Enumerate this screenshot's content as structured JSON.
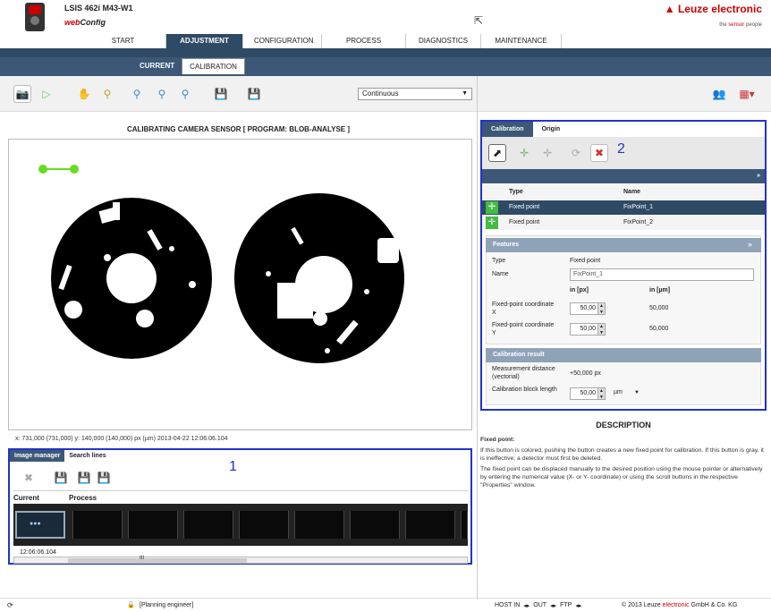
{
  "header": {
    "device_name": "LSIS 462i M43-W1",
    "web_prefix": "web",
    "config_word": "Config",
    "brand": "Leuze electronic",
    "tagline_pre": "the ",
    "tagline_sensor": "sensor",
    "tagline_post": " people"
  },
  "nav": [
    "START",
    "ADJUSTMENT",
    "CONFIGURATION",
    "PROCESS",
    "DIAGNOSTICS",
    "MAINTENANCE"
  ],
  "subtabs": [
    "CURRENT",
    "CALIBRATION"
  ],
  "toolbar": {
    "trigger_mode": "Continuous"
  },
  "main": {
    "title": "CALIBRATING CAMERA SENSOR   [ PROGRAM: BLOB-ANALYSE ]",
    "coords": "x: 731,000 (731,000) y: 140,000 (140,000) px (µm)     2013-04-22 12:06:06.104"
  },
  "image_panel": {
    "tabs": [
      "Image manager",
      "Search lines"
    ],
    "number": "1",
    "col_current": "Current",
    "col_process": "Process",
    "timestamp": "12:06:06.104",
    "scroll_mark": "III"
  },
  "calib_panel": {
    "tabs": [
      "Calibration",
      "Origin"
    ],
    "number": "2",
    "col_type": "Type",
    "col_name": "Name",
    "rows": [
      {
        "type": "Fixed point",
        "name": "FixPoint_1"
      },
      {
        "type": "Fixed point",
        "name": "FixPoint_2"
      }
    ],
    "features_title": "Features",
    "type_label": "Type",
    "type_value": "Fixed point",
    "name_label": "Name",
    "name_value": "FixPoint_1",
    "unit_px": "in [px]",
    "unit_um": "in [µm]",
    "coord_x_label": "Fixed-point coordinate X",
    "coord_x_px": "50,00",
    "coord_x_um": "50,000",
    "coord_y_label": "Fixed-point coordinate Y",
    "coord_y_px": "50,00",
    "coord_y_um": "50,000",
    "result_title": "Calibration result",
    "meas_label": "Measurement distance (vectorial)",
    "meas_value": "+50,000  px",
    "block_label": "Calibration block length",
    "block_value": "50,00",
    "block_unit": "µm"
  },
  "description": {
    "title": "DESCRIPTION",
    "heading": "Fixed point:",
    "p1": "If this button is colored, pushing the button creates a new fixed point for calibration. If this button is gray, it is ineffective; a detector must first be deleted.",
    "p2": "The fixed point can be displaced manually to the desired position using the mouse pointer or alternatively by entering the numerical value (X- or Y- coordinate) or using the scroll buttons in the respective \"Properties\" window."
  },
  "footer": {
    "role": "[Planning engineer]",
    "host_in": "HOST IN",
    "out": "OUT",
    "ftp": "FTP",
    "copyright_pre": "© 2013 Leuze ",
    "copyright_brand": "electronic",
    "copyright_post": " GmbH & Co. KG"
  },
  "colors": {
    "brand_red": "#cc0000",
    "nav_blue": "#2f4a65",
    "highlight_blue": "#2233cc",
    "point_green": "#66dd22"
  }
}
